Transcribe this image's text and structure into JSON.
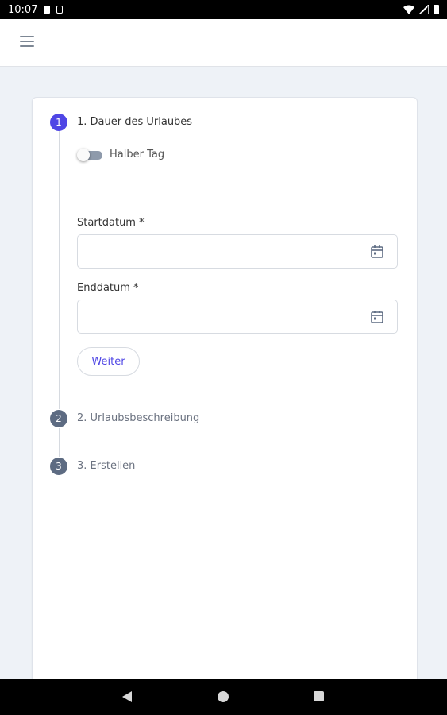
{
  "status_bar": {
    "time": "10:07"
  },
  "app_bar": {
    "menu_icon": "menu-icon"
  },
  "stepper": {
    "steps": [
      {
        "number": "1",
        "label": "1. Dauer des Urlaubes",
        "state": "active"
      },
      {
        "number": "2",
        "label": "2. Urlaubsbeschreibung",
        "state": "inactive"
      },
      {
        "number": "3",
        "label": "3. Erstellen",
        "state": "inactive"
      }
    ]
  },
  "form": {
    "half_day_label": "Halber Tag",
    "half_day_on": false,
    "start_label": "Startdatum *",
    "start_value": "",
    "end_label": "Enddatum *",
    "end_value": "",
    "next_button": "Weiter"
  },
  "colors": {
    "accent": "#4f46e5",
    "step_inactive": "#5d6b82",
    "background": "#eef2f7"
  }
}
